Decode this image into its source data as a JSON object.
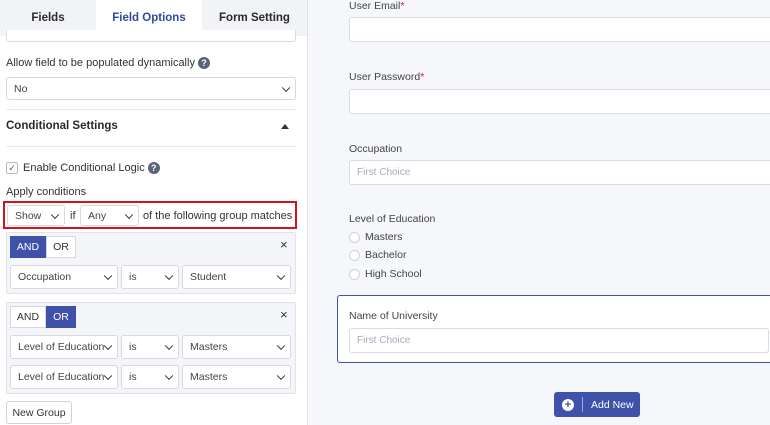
{
  "tabs": [
    "Fields",
    "Field Options",
    "Form Setting"
  ],
  "dynamic": {
    "label": "Allow field to be populated dynamically",
    "value": "No"
  },
  "conditional": {
    "title": "Conditional Settings",
    "enable_label": "Enable Conditional Logic",
    "enabled": true,
    "apply_label": "Apply conditions",
    "action": "Show",
    "if_text": "if",
    "match": "Any",
    "suffix": "of the following group matches"
  },
  "groups": [
    {
      "and_label": "AND",
      "or_label": "OR",
      "active": "AND",
      "close": "×",
      "rows": [
        {
          "field": "Occupation",
          "operator": "is",
          "value": "Student"
        }
      ]
    },
    {
      "and_label": "AND",
      "or_label": "OR",
      "active": "OR",
      "close": "×",
      "rows": [
        {
          "field": "Level of Education",
          "operator": "is",
          "value": "Masters"
        },
        {
          "field": "Level of Education",
          "operator": "is",
          "value": "Masters"
        }
      ]
    }
  ],
  "new_group_label": "New Group",
  "form": {
    "user_email_label": "User Email",
    "user_password_label": "User Password",
    "required_mark": "*",
    "occupation_label": "Occupation",
    "occupation_placeholder": "First Choice",
    "education_label": "Level of Education",
    "education_options": [
      "Masters",
      "Bachelor",
      "High School"
    ],
    "university_label": "Name of University",
    "university_placeholder": "First Choice",
    "add_new_label": "Add New"
  },
  "colors": {
    "accent": "#3f51a8",
    "highlight": "#d0141b"
  }
}
